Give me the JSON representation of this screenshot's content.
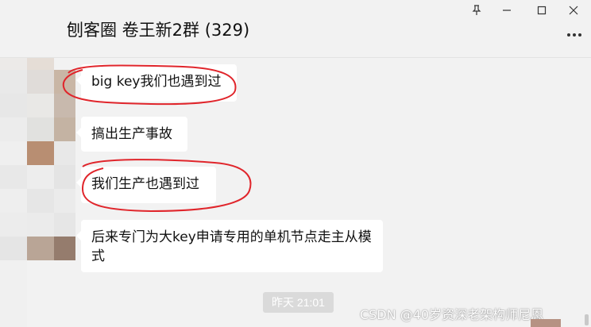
{
  "chat": {
    "title": "刨客圈 卷王新2群 (329)",
    "messages": [
      {
        "text": "big key我们也遇到过",
        "highlighted": true
      },
      {
        "text": "搞出生产事故",
        "highlighted": false
      },
      {
        "text": "我们生产也遇到过",
        "highlighted": true
      },
      {
        "text": "后来专门为大key申请专用的单机节点走主从模式",
        "highlighted": false
      }
    ],
    "timestamp": "昨天 21:01"
  },
  "window": {
    "controls": [
      "pin-icon",
      "minimize-icon",
      "maximize-icon",
      "close-icon"
    ],
    "more_icon": "more-icon"
  },
  "watermark": "CSDN @40岁资深老架构师尼恩",
  "colors": {
    "background": "#f2f2f2",
    "bubble": "#ffffff",
    "annotation": "#e0252b",
    "timestamp_bg": "#dadada"
  }
}
